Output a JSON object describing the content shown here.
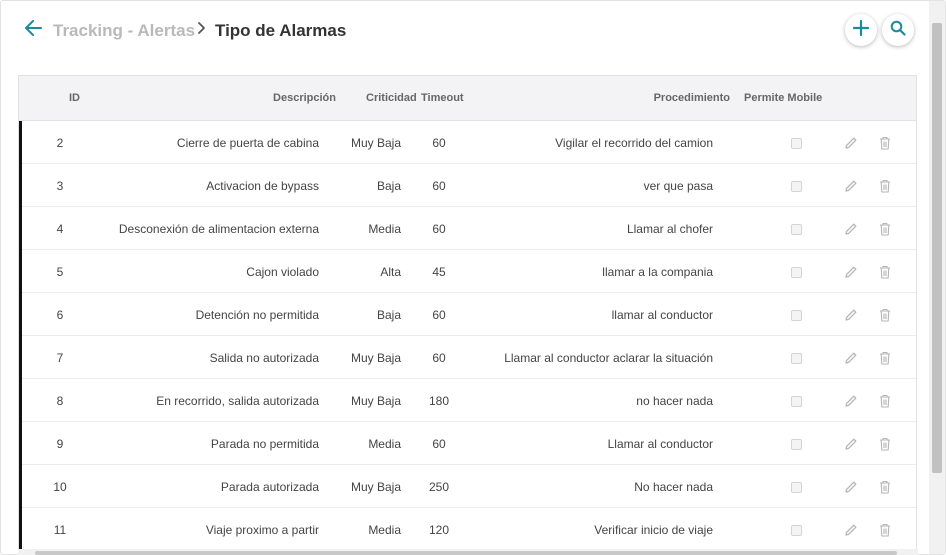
{
  "header": {
    "breadcrumb_parent": "Tracking - Alertas",
    "title": "Tipo de Alarmas"
  },
  "table": {
    "columns": {
      "id": "ID",
      "descripcion": "Descripción",
      "criticidad": "Criticidad",
      "timeout": "Timeout",
      "procedimiento": "Procedimiento",
      "permite_mobile": "Permite Mobile"
    },
    "rows": [
      {
        "id": "2",
        "descripcion": "Cierre de puerta de cabina",
        "criticidad": "Muy Baja",
        "timeout": "60",
        "procedimiento": "Vigilar el recorrido del camion",
        "permite_mobile": false
      },
      {
        "id": "3",
        "descripcion": "Activacion de bypass",
        "criticidad": "Baja",
        "timeout": "60",
        "procedimiento": "ver que pasa",
        "permite_mobile": false
      },
      {
        "id": "4",
        "descripcion": "Desconexión de alimentacion externa",
        "criticidad": "Media",
        "timeout": "60",
        "procedimiento": "Llamar al chofer",
        "permite_mobile": false
      },
      {
        "id": "5",
        "descripcion": "Cajon violado",
        "criticidad": "Alta",
        "timeout": "45",
        "procedimiento": "llamar a la compania",
        "permite_mobile": false
      },
      {
        "id": "6",
        "descripcion": "Detención no permitida",
        "criticidad": "Baja",
        "timeout": "60",
        "procedimiento": "llamar al conductor",
        "permite_mobile": false
      },
      {
        "id": "7",
        "descripcion": "Salida no autorizada",
        "criticidad": "Muy Baja",
        "timeout": "60",
        "procedimiento": "Llamar al conductor aclarar la situación",
        "permite_mobile": false
      },
      {
        "id": "8",
        "descripcion": "En recorrido, salida autorizada",
        "criticidad": "Muy Baja",
        "timeout": "180",
        "procedimiento": "no hacer nada",
        "permite_mobile": false
      },
      {
        "id": "9",
        "descripcion": "Parada no permitida",
        "criticidad": "Media",
        "timeout": "60",
        "procedimiento": "Llamar al conductor",
        "permite_mobile": false
      },
      {
        "id": "10",
        "descripcion": "Parada autorizada",
        "criticidad": "Muy Baja",
        "timeout": "250",
        "procedimiento": "No hacer nada",
        "permite_mobile": false
      },
      {
        "id": "11",
        "descripcion": "Viaje proximo a partir",
        "criticidad": "Media",
        "timeout": "120",
        "procedimiento": "Verificar inicio de viaje",
        "permite_mobile": false
      }
    ]
  },
  "icons": {
    "back": "arrow-left-icon",
    "separator": "chevron-right-icon",
    "add": "plus-icon",
    "search": "search-icon",
    "edit": "pencil-icon",
    "delete": "trash-icon"
  },
  "colors": {
    "accent": "#1a8c9c",
    "row_marker": "#111111",
    "header_bg": "#f3f3f5"
  }
}
